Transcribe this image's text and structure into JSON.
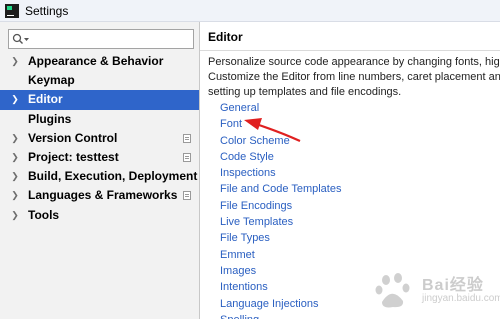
{
  "window": {
    "title": "Settings"
  },
  "search": {
    "placeholder": "",
    "value": ""
  },
  "tree": [
    {
      "label": "Appearance & Behavior",
      "expandable": true,
      "selected": false,
      "has_project_icon": false
    },
    {
      "label": "Keymap",
      "expandable": false,
      "selected": false,
      "has_project_icon": false
    },
    {
      "label": "Editor",
      "expandable": true,
      "selected": true,
      "has_project_icon": false
    },
    {
      "label": "Plugins",
      "expandable": false,
      "selected": false,
      "has_project_icon": false
    },
    {
      "label": "Version Control",
      "expandable": true,
      "selected": false,
      "has_project_icon": true
    },
    {
      "label": "Project: testtest",
      "expandable": true,
      "selected": false,
      "has_project_icon": true
    },
    {
      "label": "Build, Execution, Deployment",
      "expandable": true,
      "selected": false,
      "has_project_icon": false
    },
    {
      "label": "Languages & Frameworks",
      "expandable": true,
      "selected": false,
      "has_project_icon": true
    },
    {
      "label": "Tools",
      "expandable": true,
      "selected": false,
      "has_project_icon": false
    }
  ],
  "editor_panel": {
    "heading": "Editor",
    "description": [
      "Personalize source code appearance by changing fonts, highlight",
      "Customize the Editor from line numbers, caret placement and tab",
      "setting up templates and file encodings."
    ],
    "links": [
      "General",
      "Font",
      "Color Scheme",
      "Code Style",
      "Inspections",
      "File and Code Templates",
      "File Encodings",
      "Live Templates",
      "File Types",
      "Emmet",
      "Images",
      "Intentions",
      "Language Injections",
      "Spelling"
    ]
  },
  "watermark": {
    "text": "Bai经验",
    "sub": "jingyan.baidu.com"
  },
  "colors": {
    "selection": "#2f65ca",
    "link": "#2a5fc1",
    "annotation": "#e02020"
  },
  "icons": {
    "app": "pycharm-icon",
    "search": "search-icon",
    "expand": "chevron-right-icon",
    "project": "project-settings-icon"
  }
}
